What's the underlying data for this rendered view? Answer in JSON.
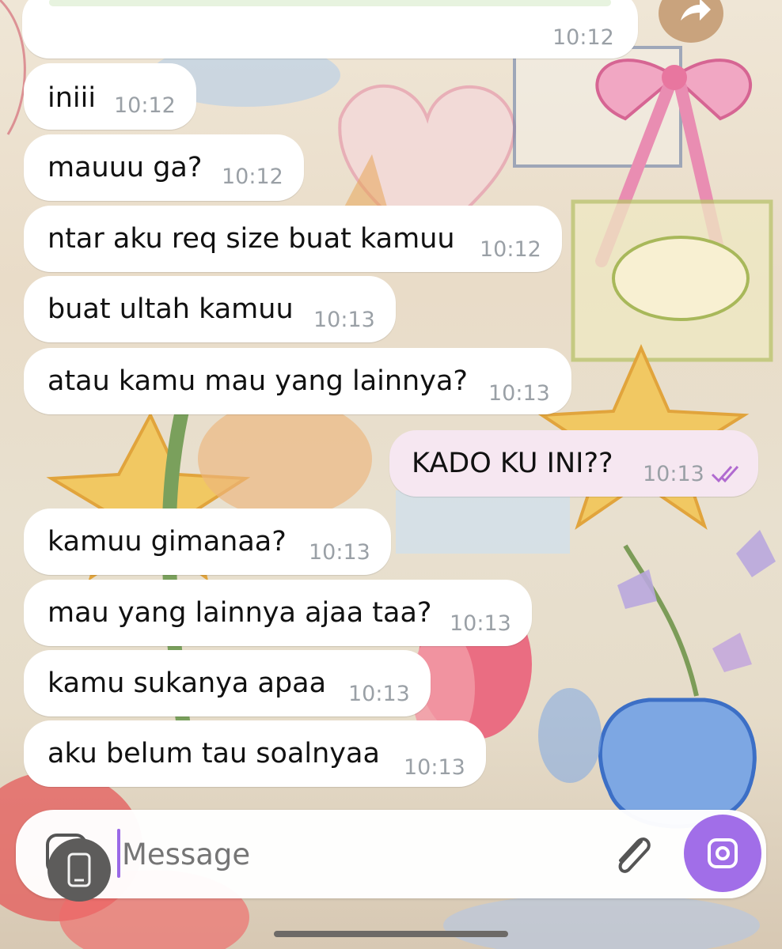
{
  "composer": {
    "placeholder": "Message"
  },
  "messages": [
    {
      "text": "",
      "time": "10:12"
    },
    {
      "text": "iniii",
      "time": "10:12"
    },
    {
      "text": "mauuu ga?",
      "time": "10:12"
    },
    {
      "text": "ntar aku req size buat kamuu",
      "time": "10:12"
    },
    {
      "text": "buat ultah kamuu",
      "time": "10:13"
    },
    {
      "text": "atau kamu mau yang lainnya?",
      "time": "10:13"
    },
    {
      "text": "KADO KU INI??",
      "time": "10:13",
      "status": "read"
    },
    {
      "text": "kamuu gimanaa?",
      "time": "10:13"
    },
    {
      "text": "mau yang lainnya ajaa taa?",
      "time": "10:13"
    },
    {
      "text": "kamu sukanya apaa",
      "time": "10:13"
    },
    {
      "text": "aku belum tau soalnyaa",
      "time": "10:13"
    }
  ],
  "colors": {
    "outgoing_bubble": "#f6e7f1",
    "incoming_bubble": "#ffffff",
    "accent": "#a16ee8",
    "read_check": "#b06ad0"
  },
  "icons": [
    "forward-icon",
    "sticker-icon",
    "phone-overlay-icon",
    "attach-icon",
    "camera-icon",
    "double-check-icon"
  ]
}
